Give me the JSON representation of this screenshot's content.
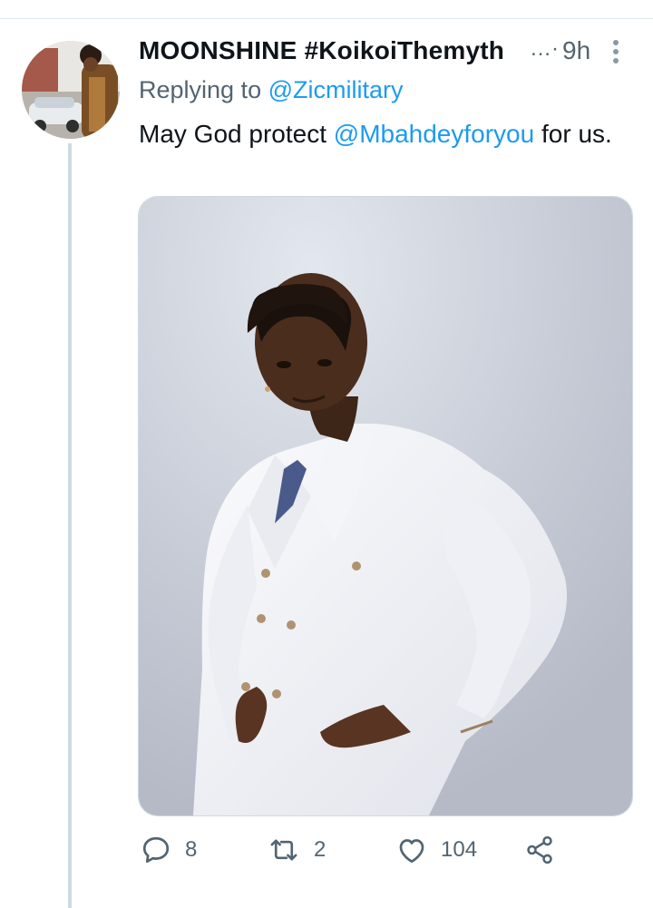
{
  "tweet": {
    "display_name": "MOONSHINE #KoikoiThemyth",
    "name_suffix": "…·",
    "time": "9h",
    "replying_prefix": "Replying to",
    "replying_handle": "@Zicmilitary",
    "text_before": "May God protect ",
    "text_mention": "@Mbahdeyforyou",
    "text_after": " for us."
  },
  "actions": {
    "reply_count": "8",
    "retweet_count": "2",
    "like_count": "104"
  },
  "icons": [
    "reply-icon",
    "retweet-icon",
    "like-icon",
    "share-icon",
    "more-icon"
  ],
  "colors": {
    "link": "#1d9bf0",
    "secondary_text": "#536471",
    "thread_line": "#cfd9de"
  }
}
